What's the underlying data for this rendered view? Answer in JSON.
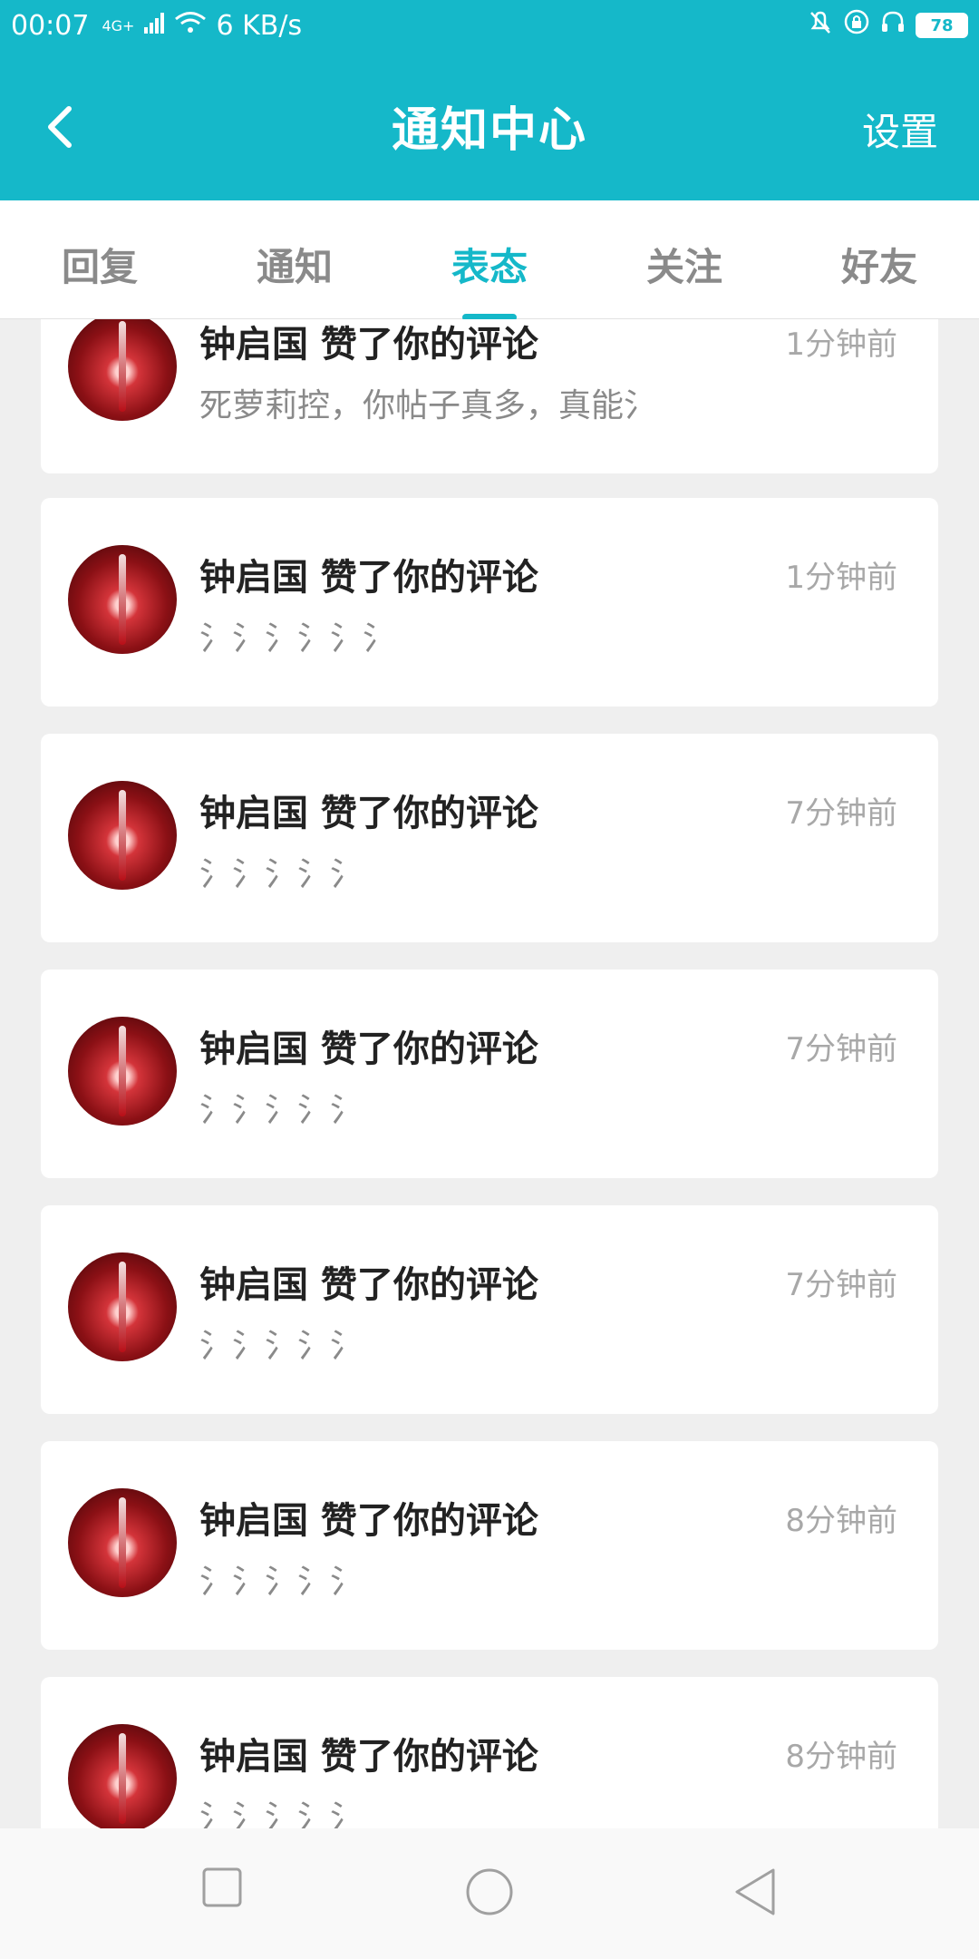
{
  "status_bar": {
    "time": "00:07",
    "network": "4G+",
    "speed": "6 KB/s",
    "battery": "78"
  },
  "header": {
    "title": "通知中心",
    "settings_label": "设置"
  },
  "tabs": [
    {
      "label": "回复",
      "active": false
    },
    {
      "label": "通知",
      "active": false
    },
    {
      "label": "表态",
      "active": true
    },
    {
      "label": "关注",
      "active": false
    },
    {
      "label": "好友",
      "active": false
    }
  ],
  "notifications": [
    {
      "title": "钟启国 赞了你的评论",
      "time": "1分钟前",
      "content": "死萝莉控，你帖子真多，真能氵"
    },
    {
      "title": "钟启国 赞了你的评论",
      "time": "1分钟前",
      "content": "氵氵氵氵氵氵"
    },
    {
      "title": "钟启国 赞了你的评论",
      "time": "7分钟前",
      "content": "氵氵氵氵氵"
    },
    {
      "title": "钟启国 赞了你的评论",
      "time": "7分钟前",
      "content": "氵氵氵氵氵"
    },
    {
      "title": "钟启国 赞了你的评论",
      "time": "7分钟前",
      "content": "氵氵氵氵氵"
    },
    {
      "title": "钟启国 赞了你的评论",
      "time": "8分钟前",
      "content": "氵氵氵氵氵"
    },
    {
      "title": "钟启国 赞了你的评论",
      "time": "8分钟前",
      "content": "氵氵氵氵氵"
    }
  ],
  "colors": {
    "accent": "#15b8c9",
    "background": "#efefef"
  }
}
